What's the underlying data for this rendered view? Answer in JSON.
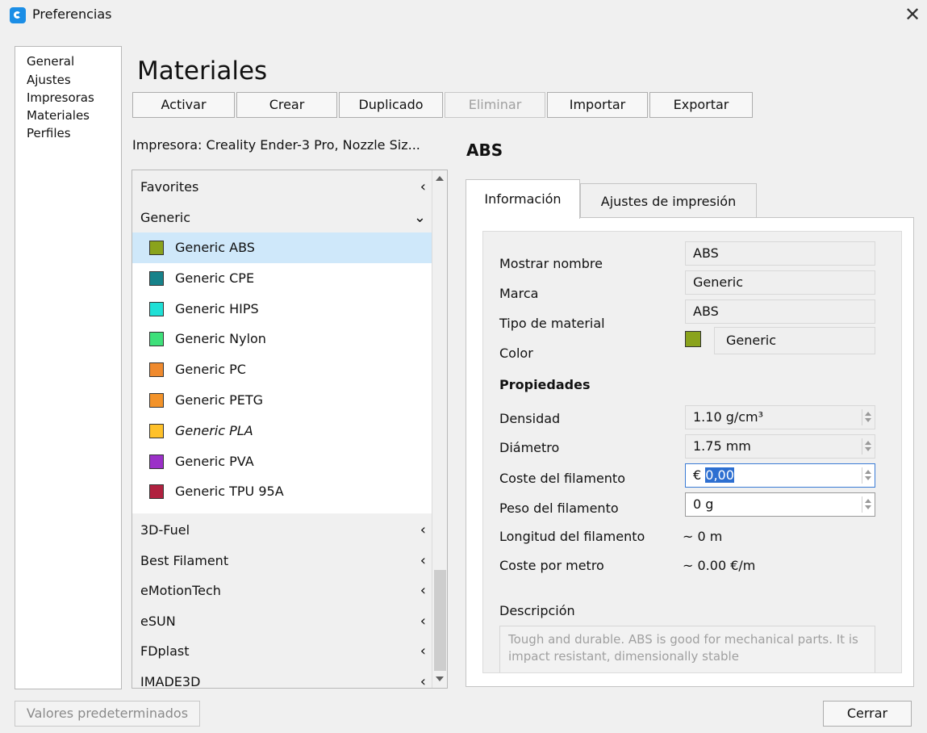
{
  "window": {
    "title": "Preferencias",
    "close_glyph": "✕"
  },
  "nav": {
    "items": [
      "General",
      "Ajustes",
      "Impresoras",
      "Materiales",
      "Perfiles"
    ]
  },
  "page": {
    "title": "Materiales"
  },
  "toolbar": {
    "activate": "Activar",
    "create": "Crear",
    "duplicate": "Duplicado",
    "delete": "Eliminar",
    "import": "Importar",
    "export": "Exportar"
  },
  "printer_label": "Impresora: Creality Ender-3 Pro, Nozzle Siz...",
  "material_title": "ABS",
  "list": {
    "categories_top": [
      {
        "label": "Favorites",
        "chevron": "‹"
      },
      {
        "label": "Generic",
        "chevron": "⌄"
      }
    ],
    "generic_items": [
      {
        "label": "Generic ABS",
        "color": "#8aa31c",
        "selected": true
      },
      {
        "label": "Generic CPE",
        "color": "#16828a"
      },
      {
        "label": "Generic HIPS",
        "color": "#1fe0d6"
      },
      {
        "label": "Generic Nylon",
        "color": "#3ee07a"
      },
      {
        "label": "Generic PC",
        "color": "#ef8a2e"
      },
      {
        "label": "Generic PETG",
        "color": "#f3932a"
      },
      {
        "label": "Generic PLA",
        "color": "#ffc12a",
        "italic": true
      },
      {
        "label": "Generic PVA",
        "color": "#9b30c8"
      },
      {
        "label": "Generic TPU 95A",
        "color": "#b0213f"
      }
    ],
    "categories_bottom": [
      {
        "label": "3D-Fuel",
        "chevron": "‹"
      },
      {
        "label": "Best Filament",
        "chevron": "‹"
      },
      {
        "label": "eMotionTech",
        "chevron": "‹"
      },
      {
        "label": "eSUN",
        "chevron": "‹"
      },
      {
        "label": "FDplast",
        "chevron": "‹"
      },
      {
        "label": "IMADE3D",
        "chevron": "‹"
      }
    ]
  },
  "tabs": {
    "info": "Información",
    "print_settings": "Ajustes de impresión"
  },
  "info": {
    "display_name_label": "Mostrar nombre",
    "display_name": "ABS",
    "brand_label": "Marca",
    "brand": "Generic",
    "material_type_label": "Tipo de material",
    "material_type": "ABS",
    "color_label": "Color",
    "color_name": "Generic",
    "color_swatch": "#8aa31c"
  },
  "properties": {
    "heading": "Propiedades",
    "density_label": "Densidad",
    "density": "1.10 g/cm³",
    "diameter_label": "Diámetro",
    "diameter": "1.75 mm",
    "cost_label": "Coste del filamento",
    "cost_currency": "€",
    "cost_value": "0,00",
    "weight_label": "Peso del filamento",
    "weight": "0 g",
    "length_label": "Longitud del filamento",
    "length": "~ 0 m",
    "cost_per_meter_label": "Coste por metro",
    "cost_per_meter": "~ 0.00 €/m",
    "description_label": "Descripción",
    "description": "Tough and durable. ABS is good for mechanical parts. It is impact resistant, dimensionally stable"
  },
  "footer": {
    "defaults": "Valores predeterminados",
    "close": "Cerrar"
  }
}
